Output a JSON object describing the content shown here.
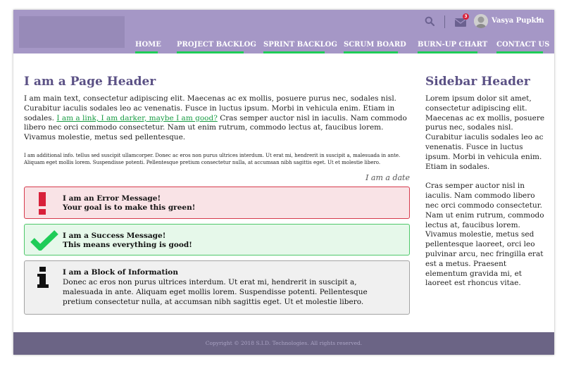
{
  "header": {
    "user_name": "Vasya Pupkin",
    "mail_badge_count": "3",
    "nav": [
      {
        "label": "HOME"
      },
      {
        "label": "PROJECT BACKLOG"
      },
      {
        "label": "SPRINT BACKLOG"
      },
      {
        "label": "SCRUM BOARD"
      },
      {
        "label": "BURN-UP CHART"
      },
      {
        "label": "CONTACT US"
      }
    ],
    "icons": [
      "search-icon",
      "mail-icon",
      "avatar",
      "chevron-down-icon"
    ]
  },
  "main": {
    "title": "I am a Page Header",
    "text_before_link": "I am main text, consectetur adipiscing elit. Maecenas ac ex mollis, posuere purus nec, sodales nisl. Curabitur iaculis sodales leo ac venenatis. Fusce in luctus ipsum. Morbi in vehicula enim. Etiam in sodales.",
    "link_text": "I am a link, I am darker, maybe I am good?",
    "text_after_link": "Cras semper auctor nisl in iaculis. Nam commodo libero nec orci commodo consectetur. Nam ut enim rutrum, commodo lectus at, faucibus lorem. Vivamus molestie, metus sed pellentesque.",
    "additional_info": "I am additional info. tellus sed suscipit ullamcorper. Donec ac eros non purus ultrices interdum. Ut erat mi, hendrerit in suscipit a, malesuada in ante. Aliquam eget mollis lorem. Suspendisse potenti. Pellentesque pretium consectetur nulla, at accumsan nibh sagittis eget. Ut et molestie libero.",
    "date": "I am a date"
  },
  "messages": {
    "error": {
      "title": "I am an Error Message!",
      "body": "Your goal is to make this green!",
      "icon": "exclamation-icon",
      "color": "#d8213a"
    },
    "success": {
      "title": "I am a Success Message!",
      "body": "This means everything is good!",
      "icon": "checkmark-icon",
      "color": "#1fcc58"
    },
    "info": {
      "title": "I am a Block of Information",
      "body": "Donec ac eros non purus ultrices interdum. Ut erat mi, hendrerit in suscipit a, malesuada in ante. Aliquam eget mollis lorem. Suspendisse potenti. Pellentesque pretium consectetur nulla, at accumsan nibh sagittis eget. Ut et molestie libero.",
      "icon": "info-icon",
      "color": "#111111"
    }
  },
  "sidebar": {
    "title": "Sidebar Header",
    "text1": "Lorem ipsum dolor sit amet, consectetur adipiscing elit. Maecenas ac ex mollis, posuere purus nec, sodales nisl. Curabitur iaculis sodales leo ac venenatis. Fusce in luctus ipsum. Morbi in vehicula enim. Etiam in sodales.",
    "text2": "Cras semper auctor nisl in iaculis. Nam commodo libero nec orci commodo consectetur. Nam ut enim rutrum, commodo lectus at, faucibus lorem. Vivamus molestie, metus sed pellentesque laoreet, orci leo pulvinar arcu, nec fringilla erat est a metus. Praesent elementum gravida mi, et laoreet est rhoncus vitae."
  },
  "footer": {
    "text": "Copyright © 2018 S.I.D. Technologies. All rights reserved."
  },
  "colors": {
    "header_bg": "#a597c6",
    "accent_green": "#1fcc58",
    "title_purple": "#5b5185",
    "footer_bg": "#6b6485"
  }
}
